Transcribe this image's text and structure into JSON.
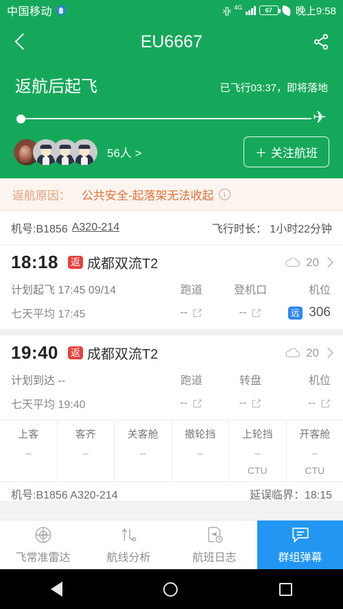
{
  "status_bar": {
    "carrier": "中国移动",
    "network": "4G",
    "battery": "67",
    "time": "晚上9:58"
  },
  "header": {
    "title": "EU6667",
    "back_icon": "chevron-left-icon",
    "share_icon": "share-icon",
    "state_main": "返航后起飞",
    "state_sub": "已飞行03:37，即将落地",
    "people_count": "56人 >",
    "follow_label": "关注航班",
    "follow_plus": "＋"
  },
  "reason": {
    "label": "返航原因：",
    "text": "公共安全-起落架无法收起",
    "info_icon": "i",
    "label_color": "#e8a27a",
    "text_color": "#e2733a"
  },
  "plane_info": {
    "reg": "机号:B1856",
    "model": "A320-214",
    "duration": "飞行时长： 1小时22分钟"
  },
  "departure": {
    "time": "18:18",
    "badge": "返",
    "airport": "成都双流T2",
    "weather_temp": "20",
    "sched_label": "计划起飞 17:45 09/14",
    "avg_label": "七天平均 17:45",
    "col_headers": [
      "跑道",
      "登机口",
      "机位"
    ],
    "col_values": [
      "--",
      "--",
      "306"
    ],
    "stand_badge": "远"
  },
  "arrival": {
    "time": "19:40",
    "badge": "返",
    "airport": "成都双流T2",
    "weather_temp": "20",
    "sched_label": "计划到达 --",
    "avg_label": "七天平均 19:40",
    "col_headers": [
      "跑道",
      "转盘",
      "机位"
    ],
    "col_values": [
      "--",
      "--",
      "--"
    ]
  },
  "status_grid": [
    {
      "label": "上客",
      "value": "–",
      "sub": ""
    },
    {
      "label": "客齐",
      "value": "–",
      "sub": ""
    },
    {
      "label": "关客舱",
      "value": "–",
      "sub": ""
    },
    {
      "label": "撤轮挡",
      "value": "–",
      "sub": ""
    },
    {
      "label": "上轮挡",
      "value": "–",
      "sub": "CTU"
    },
    {
      "label": "开客舱",
      "value": "–",
      "sub": "CTU"
    }
  ],
  "cut_row": {
    "left": "机号:B1856  A320-214",
    "right": "延误临界：18:15"
  },
  "bottom_nav": [
    {
      "label": "飞常准雷达",
      "icon": "radar-icon",
      "active": false
    },
    {
      "label": "航线分析",
      "icon": "route-analysis-icon",
      "active": false
    },
    {
      "label": "航班日志",
      "icon": "flight-log-icon",
      "active": false
    },
    {
      "label": "群组弹幕",
      "icon": "chat-bubble-icon",
      "active": true
    }
  ],
  "android_nav": {
    "back": "back-triangle",
    "home": "home-circle",
    "recents": "recents-square"
  },
  "colors": {
    "brand_green": "#16a85a",
    "badge_red": "#e8413c",
    "badge_blue": "#2f86ef",
    "active_blue": "#2196f3"
  }
}
